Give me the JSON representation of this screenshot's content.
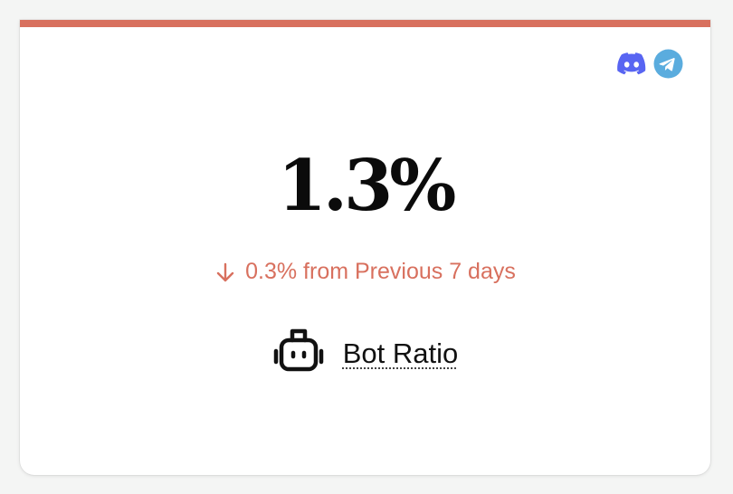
{
  "metric": {
    "value": "1.3%",
    "change_text": "0.3% from Previous 7 days",
    "change_direction": "down",
    "label": "Bot Ratio",
    "label_icon": "robot-icon"
  },
  "social": {
    "items": [
      {
        "icon": "discord-icon",
        "color": "#5865F2"
      },
      {
        "icon": "telegram-icon",
        "color": "#5aacde"
      }
    ]
  },
  "colors": {
    "accent": "#d8705e",
    "change_negative": "#d8705e",
    "value_text": "#0b0b0b"
  }
}
